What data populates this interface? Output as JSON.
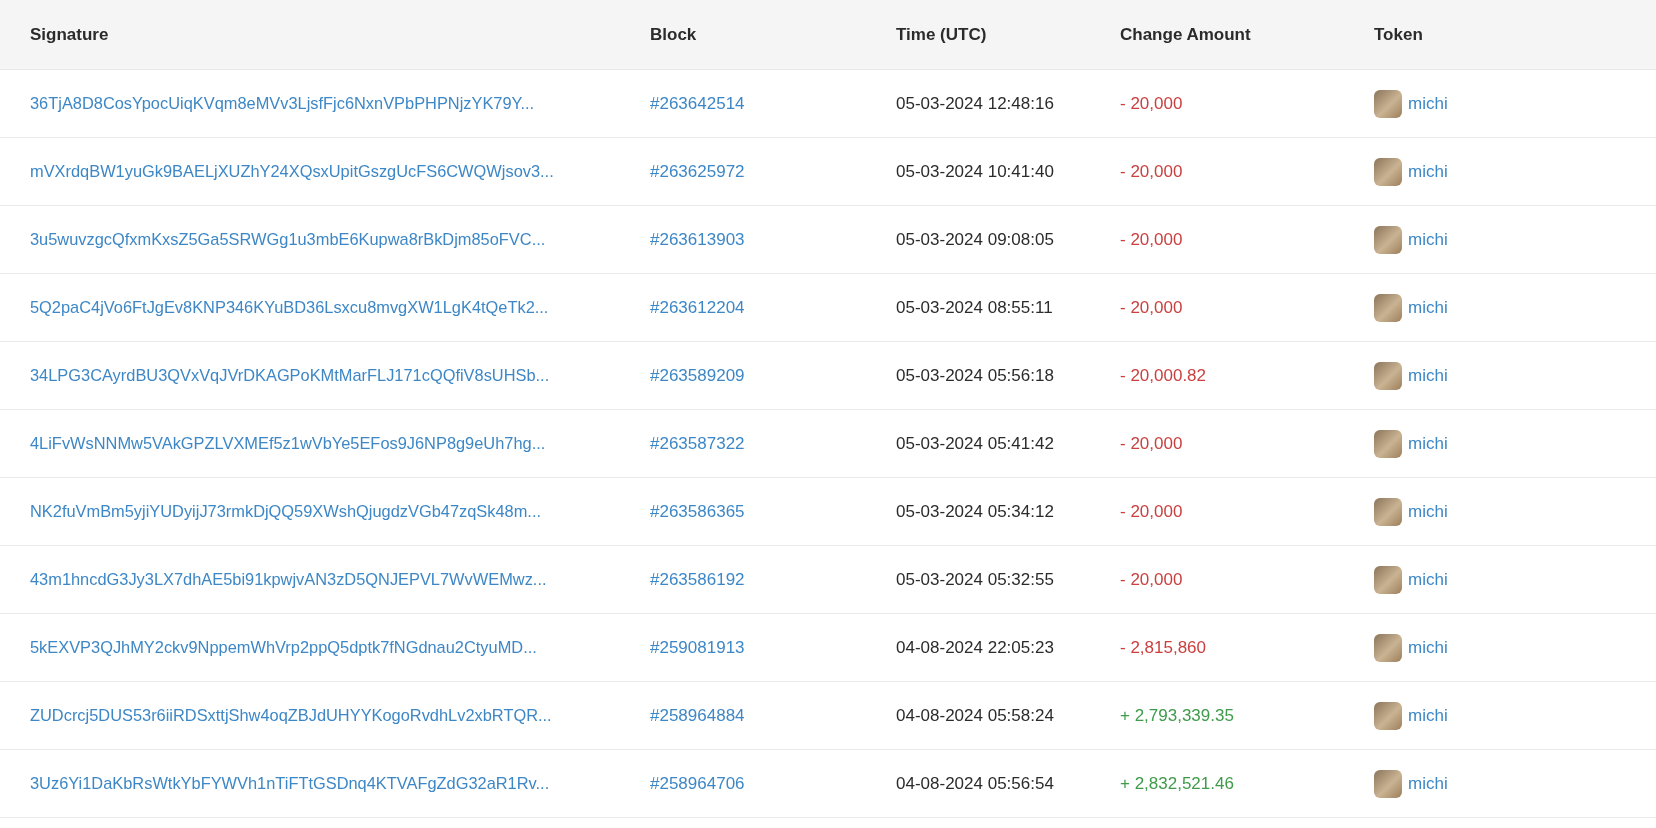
{
  "table": {
    "columns": [
      "Signature",
      "Block",
      "Time (UTC)",
      "Change Amount",
      "Token"
    ],
    "rows": [
      {
        "signature": "36TjA8D8CosYpocUiqKVqm8eMVv3LjsfFjc6NxnVPbPHPNjzYK79Y...",
        "block": "#263642514",
        "time": "05-03-2024 12:48:16",
        "amount": "- 20,000",
        "kind": "out",
        "token": "michi"
      },
      {
        "signature": "mVXrdqBW1yuGk9BAELjXUZhY24XQsxUpitGszgUcFS6CWQWjsov3...",
        "block": "#263625972",
        "time": "05-03-2024 10:41:40",
        "amount": "- 20,000",
        "kind": "out",
        "token": "michi"
      },
      {
        "signature": "3u5wuvzgcQfxmKxsZ5Ga5SRWGg1u3mbE6Kupwa8rBkDjm85oFVC...",
        "block": "#263613903",
        "time": "05-03-2024 09:08:05",
        "amount": "- 20,000",
        "kind": "out",
        "token": "michi"
      },
      {
        "signature": "5Q2paC4jVo6FtJgEv8KNP346KYuBD36Lsxcu8mvgXW1LgK4tQeTk2...",
        "block": "#263612204",
        "time": "05-03-2024 08:55:11",
        "amount": "- 20,000",
        "kind": "out",
        "token": "michi"
      },
      {
        "signature": "34LPG3CAyrdBU3QVxVqJVrDKAGPoKMtMarFLJ171cQQfiV8sUHSb...",
        "block": "#263589209",
        "time": "05-03-2024 05:56:18",
        "amount": "- 20,000.82",
        "kind": "out",
        "token": "michi"
      },
      {
        "signature": "4LiFvWsNNMw5VAkGPZLVXMEf5z1wVbYe5EFos9J6NP8g9eUh7hg...",
        "block": "#263587322",
        "time": "05-03-2024 05:41:42",
        "amount": "- 20,000",
        "kind": "out",
        "token": "michi"
      },
      {
        "signature": "NK2fuVmBm5yjiYUDyijJ73rmkDjQQ59XWshQjugdzVGb47zqSk48m...",
        "block": "#263586365",
        "time": "05-03-2024 05:34:12",
        "amount": "- 20,000",
        "kind": "out",
        "token": "michi"
      },
      {
        "signature": "43m1hncdG3Jy3LX7dhAE5bi91kpwjvAN3zD5QNJEPVL7WvWEMwz...",
        "block": "#263586192",
        "time": "05-03-2024 05:32:55",
        "amount": "- 20,000",
        "kind": "out",
        "token": "michi"
      },
      {
        "signature": "5kEXVP3QJhMY2ckv9NppemWhVrp2ppQ5dptk7fNGdnau2CtyuMD...",
        "block": "#259081913",
        "time": "04-08-2024 22:05:23",
        "amount": "- 2,815,860",
        "kind": "out",
        "token": "michi"
      },
      {
        "signature": "ZUDcrcj5DUS53r6iiRDSxttjShw4oqZBJdUHYYKogoRvdhLv2xbRTQR...",
        "block": "#258964884",
        "time": "04-08-2024 05:58:24",
        "amount": "+ 2,793,339.35",
        "kind": "in",
        "token": "michi"
      },
      {
        "signature": "3Uz6Yi1DaKbRsWtkYbFYWVh1nTiFTtGSDnq4KTVAFgZdG32aR1Rv...",
        "block": "#258964706",
        "time": "04-08-2024 05:56:54",
        "amount": "+ 2,832,521.46",
        "kind": "in",
        "token": "michi"
      }
    ]
  }
}
